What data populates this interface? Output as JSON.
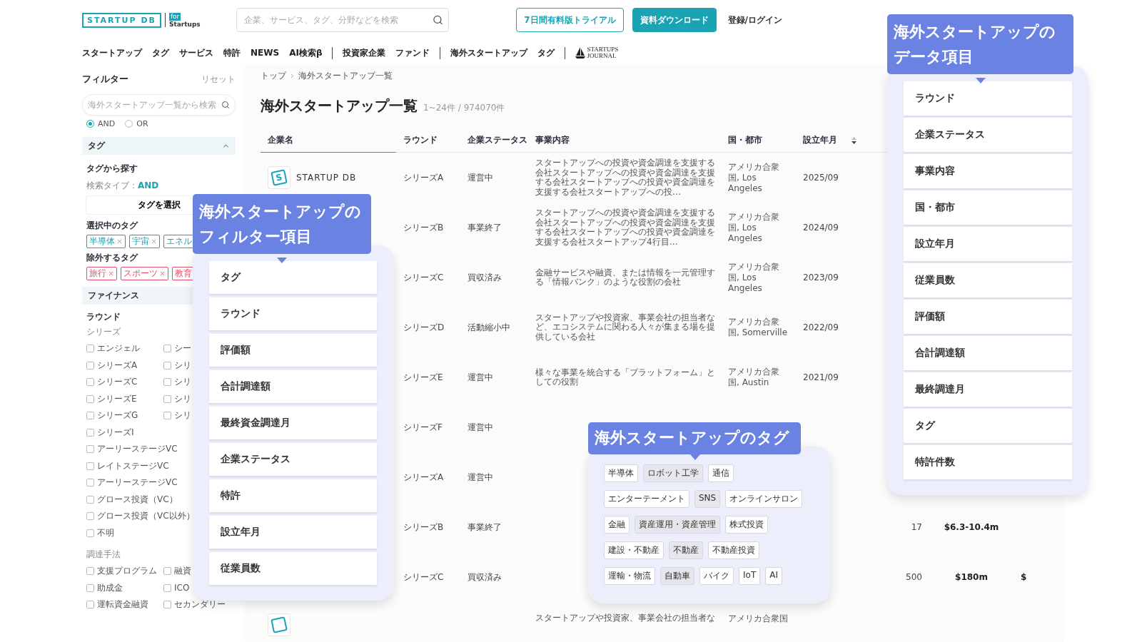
{
  "header": {
    "logo": "STARTUP DB",
    "logo_badge_top": "for",
    "logo_badge_bottom": "Startups",
    "search": {
      "placeholder": "企業、サービス、タグ、分野などを検索"
    },
    "buttons": [
      {
        "label": "7日間有料版トライアル",
        "kind": "outline"
      },
      {
        "label": "資料ダウンロード",
        "kind": "filled"
      },
      {
        "label": "登録/ログイン",
        "kind": "text"
      }
    ]
  },
  "nav": {
    "groups": [
      [
        "スタートアップ",
        "タグ",
        "サービス",
        "特許",
        "NEWS",
        "AI検索β"
      ],
      [
        "投資家企業",
        "ファンド"
      ],
      [
        "海外スタートアップ",
        "タグ"
      ]
    ],
    "journal": {
      "line1": "STARTUPS",
      "line2": "JOURNAL"
    }
  },
  "sidebar": {
    "title": "フィルター",
    "reset": "リセット",
    "search": {
      "placeholder": "海外スタートアップ一覧から検索"
    },
    "match": [
      {
        "label": "AND",
        "selected": true
      },
      {
        "label": "OR",
        "selected": false
      }
    ],
    "tag_section": {
      "title": "タグ",
      "expanded": true,
      "heading": "タグから探す",
      "search_type_label": "検索タイプ：",
      "search_type_value": "AND",
      "select_button": "タグを選択",
      "included_label": "選択中のタグ",
      "included": [
        "半導体",
        "宇宙",
        "エネル"
      ],
      "excluded_label": "除外するタグ",
      "excluded": [
        "旅行",
        "スポーツ",
        "教育"
      ]
    },
    "finance_section": {
      "title": "ファイナンス",
      "round_label": "ラウンド",
      "series_label": "シリーズ",
      "series_rows": [
        [
          {
            "label": "エンジェル",
            "checked": false
          },
          {
            "label": "シー",
            "checked": false
          }
        ],
        [
          {
            "label": "シリーズA",
            "checked": false
          },
          {
            "label": "シリ",
            "checked": false
          }
        ],
        [
          {
            "label": "シリーズC",
            "checked": false
          },
          {
            "label": "シリ",
            "checked": false
          }
        ],
        [
          {
            "label": "シリーズE",
            "checked": false
          },
          {
            "label": "シリ",
            "checked": false
          }
        ],
        [
          {
            "label": "シリーズG",
            "checked": false
          },
          {
            "label": "シリ",
            "checked": false
          }
        ],
        [
          {
            "label": "シリーズI",
            "checked": false
          }
        ],
        [
          {
            "label": "アーリーステージVC",
            "checked": false
          }
        ],
        [
          {
            "label": "レイトステージVC",
            "checked": false
          }
        ],
        [
          {
            "label": "アーリーステージVC",
            "checked": false
          }
        ],
        [
          {
            "label": "グロース投資（VC）",
            "checked": false
          }
        ],
        [
          {
            "label": "グロース投資（VC以外）",
            "checked": false
          }
        ],
        [
          {
            "label": "不明",
            "checked": false
          }
        ]
      ],
      "method_label": "調達手法",
      "method_rows": [
        [
          {
            "label": "支援プログラム",
            "checked": false
          },
          {
            "label": "融資",
            "checked": false
          }
        ],
        [
          {
            "label": "助成金",
            "checked": false
          },
          {
            "label": "ICO",
            "checked": false
          }
        ],
        [
          {
            "label": "運転資金融資",
            "checked": false
          },
          {
            "label": "セカンダリー",
            "checked": false
          }
        ]
      ]
    }
  },
  "breadcrumb": [
    "トップ",
    "海外スタートアップ一覧"
  ],
  "page_title": "海外スタートアップ一覧",
  "count": "1~24件 / 974070件",
  "table": {
    "columns": [
      {
        "label": "企業名"
      },
      {
        "label": "ラウンド"
      },
      {
        "label": "企業ステータス"
      },
      {
        "label": "事業内容"
      },
      {
        "label": "国・都市"
      },
      {
        "label": "設立年月",
        "sortable": true
      }
    ],
    "rows": [
      {
        "company": {
          "name": "STARTUP DB",
          "logo_text": "S"
        },
        "round": "シリーズA",
        "status": "運営中",
        "business": "スタートアップへの投資や資金調達を支援する会社スタートアップへの投資や資金調達を支援する会社スタートアップへの投資や資金調達を支援する会社スタートアップへの投…",
        "location": "アメリカ合衆国, Los Angeles",
        "founded": "2025/09"
      },
      {
        "round": "シリーズB",
        "status": "事業終了",
        "business": "スタートアップへの投資や資金調達を支援する会社スタートアップへの投資や資金調達を支援する会社スタートアップへの投資や資金調達を支援する会社スタートアップ4行目…",
        "location": "アメリカ合衆国, Los Angeles",
        "founded": "2024/09"
      },
      {
        "round": "シリーズC",
        "status": "買収済み",
        "business": "金融サービスや融資、または情報を一元管理する「情報バンク」のような役割の会社",
        "location": "アメリカ合衆国, Los Angeles",
        "founded": "2023/09"
      },
      {
        "round": "シリーズD",
        "status": "活動縮小中",
        "business": "スタートアップや投資家、事業会社の担当者など、エコシステムに関わる人々が集まる場を提供している会社",
        "location": "アメリカ合衆国, Somerville",
        "founded": "2022/09"
      },
      {
        "round": "シリーズE",
        "status": "運営中",
        "business": "様々な事業を統合する「プラットフォーム」としての役割",
        "location": "アメリカ合衆国, Austin",
        "founded": "2021/09"
      },
      {
        "round": "シリーズF",
        "status": "運営中"
      },
      {
        "round": "シリーズA",
        "status": "運営中"
      },
      {
        "round": "シリーズB",
        "status": "事業終了",
        "column_7": "17",
        "column_8": "$6.3-10.4m"
      },
      {
        "round": "シリーズC",
        "status": "買収済み",
        "column_7": "500",
        "column_8": "$180m",
        "column_9": "$"
      },
      {
        "logo": true,
        "business": "スタートアップや投資家、事業会社の担当者な",
        "location": "アメリカ合衆国"
      }
    ]
  },
  "filter_callout": {
    "title": "海外スタートアップのフィルター項目",
    "items": [
      "タグ",
      "ラウンド",
      "評価額",
      "合計調達額",
      "最終資金調達月",
      "企業ステータス",
      "特許",
      "設立年月",
      "従業員数"
    ]
  },
  "tag_callout": {
    "title": "海外スタートアップのタグ",
    "tag_rows": [
      [
        {
          "label": "半導体",
          "highlighted": false
        },
        {
          "label": "ロボット工学",
          "highlighted": true
        },
        {
          "label": "通信",
          "highlighted": false
        }
      ],
      [
        {
          "label": "エンターテーメント",
          "highlighted": false
        },
        {
          "label": "SNS",
          "highlighted": true
        },
        {
          "label": "オンラインサロン",
          "highlighted": false
        }
      ],
      [
        {
          "label": "金融",
          "highlighted": false
        },
        {
          "label": "資産運用・資産管理",
          "highlighted": true
        },
        {
          "label": "株式投資",
          "highlighted": false
        }
      ],
      [
        {
          "label": "建設・不動産",
          "highlighted": false
        },
        {
          "label": "不動産",
          "highlighted": true
        },
        {
          "label": "不動産投資",
          "highlighted": false
        }
      ],
      [
        {
          "label": "運輸・物流",
          "highlighted": false
        },
        {
          "label": "自動車",
          "highlighted": true
        },
        {
          "label": "バイク",
          "highlighted": false
        },
        {
          "label": "IoT",
          "highlighted": false
        },
        {
          "label": "AI",
          "highlighted": false
        }
      ]
    ]
  },
  "data_callout": {
    "title": "海外スタートアップのデータ項目",
    "items": [
      "ラウンド",
      "企業ステータス",
      "事業内容",
      "国・都市",
      "設立年月",
      "従業員数",
      "評価額",
      "合計調達額",
      "最終調達月",
      "タグ",
      "特許件数"
    ]
  }
}
